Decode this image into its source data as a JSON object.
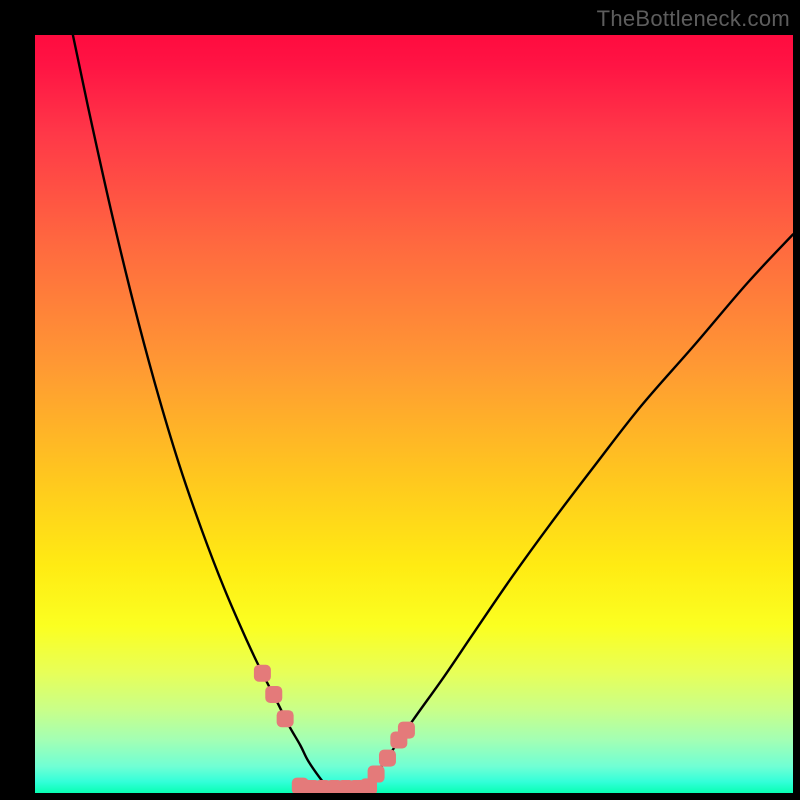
{
  "watermark": "TheBottleneck.com",
  "chart_data": {
    "type": "line",
    "title": "",
    "xlabel": "",
    "ylabel": "",
    "xlim": [
      0,
      100
    ],
    "ylim": [
      0,
      100
    ],
    "grid": false,
    "series": [
      {
        "name": "left-curve",
        "x": [
          5,
          7,
          10,
          13,
          16,
          19,
          22,
          25,
          28,
          30,
          32,
          33.5,
          35,
          36,
          37.5,
          38.8
        ],
        "values": [
          100,
          90.5,
          77,
          64.6,
          53.4,
          43.4,
          34.7,
          26.9,
          20,
          15.8,
          11.9,
          8.9,
          6.3,
          4.3,
          2.1,
          0.5
        ]
      },
      {
        "name": "right-curve",
        "x": [
          43.5,
          45,
          47,
          50,
          54,
          58,
          63,
          68,
          74,
          80,
          87,
          94,
          100
        ],
        "values": [
          0.6,
          2.5,
          5.4,
          9.8,
          15.4,
          21.3,
          28.6,
          35.5,
          43.4,
          51.1,
          59.1,
          67.3,
          73.7
        ]
      }
    ],
    "markers": {
      "name": "highlight-markers",
      "color": "#e47a7a",
      "points": [
        {
          "x": 30.0,
          "y": 15.8
        },
        {
          "x": 31.5,
          "y": 13.0
        },
        {
          "x": 33.0,
          "y": 9.8
        },
        {
          "x": 35.0,
          "y": 0.9
        },
        {
          "x": 36.5,
          "y": 0.6
        },
        {
          "x": 38.0,
          "y": 0.6
        },
        {
          "x": 39.5,
          "y": 0.6
        },
        {
          "x": 41.0,
          "y": 0.6
        },
        {
          "x": 42.5,
          "y": 0.6
        },
        {
          "x": 44.0,
          "y": 0.8
        },
        {
          "x": 45.0,
          "y": 2.5
        },
        {
          "x": 46.5,
          "y": 4.6
        },
        {
          "x": 48.0,
          "y": 7.0
        },
        {
          "x": 49.0,
          "y": 8.3
        }
      ]
    },
    "gradient_stops": [
      {
        "pct": 0,
        "color": "#ff0b3f"
      },
      {
        "pct": 4,
        "color": "#ff1444"
      },
      {
        "pct": 13,
        "color": "#ff3848"
      },
      {
        "pct": 28,
        "color": "#ff6a3f"
      },
      {
        "pct": 44,
        "color": "#ff9a33"
      },
      {
        "pct": 58,
        "color": "#ffc61f"
      },
      {
        "pct": 70,
        "color": "#ffeb13"
      },
      {
        "pct": 78,
        "color": "#fbff21"
      },
      {
        "pct": 84,
        "color": "#e8ff57"
      },
      {
        "pct": 89,
        "color": "#c9ff89"
      },
      {
        "pct": 93,
        "color": "#a3ffb4"
      },
      {
        "pct": 96.5,
        "color": "#70ffd4"
      },
      {
        "pct": 98.5,
        "color": "#33ffd9"
      },
      {
        "pct": 100,
        "color": "#08ffb3"
      }
    ]
  }
}
